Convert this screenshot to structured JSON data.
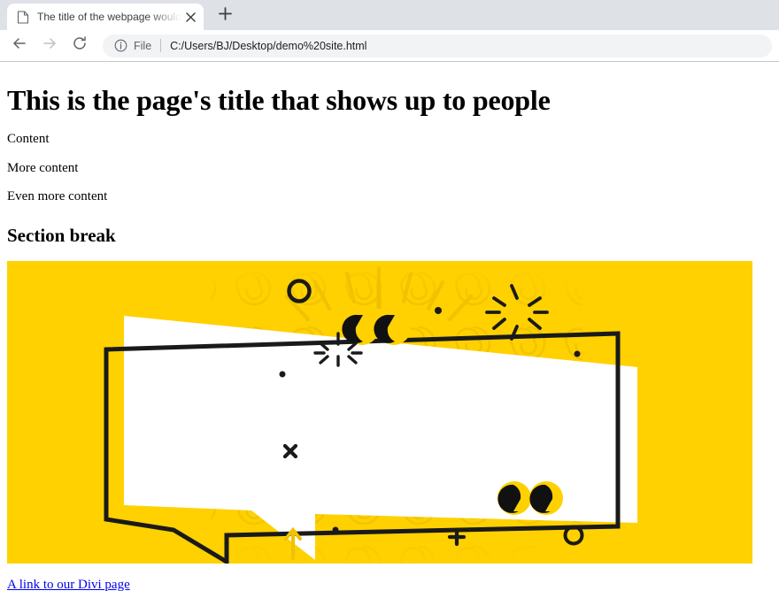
{
  "browser": {
    "tab": {
      "favicon_icon": "document-icon",
      "title": "The title of the webpage would g",
      "close_icon": "close-icon"
    },
    "new_tab_icon": "plus-icon",
    "toolbar": {
      "back_icon": "arrow-left-icon",
      "forward_icon": "arrow-right-icon",
      "reload_icon": "reload-icon",
      "info_icon": "info-circle-icon",
      "scheme_label": "File",
      "url": "C:/Users/BJ/Desktop/demo%20site.html"
    }
  },
  "page": {
    "heading": "This is the page's title that shows up to people",
    "paragraphs": [
      "Content",
      "More content",
      "Even more content"
    ],
    "section_heading": "Section break",
    "link_text": "A link to our Divi page"
  },
  "illustration": {
    "name": "yellow-speech-bubble-quote-graphic",
    "background_color": "#FFD100",
    "swirl_color": "#F2C200",
    "bubble_fill": "#FFFFFF",
    "outline_color": "#1A1A1A",
    "accent_color": "#FFD100",
    "open_quote": "“",
    "close_quote": "”",
    "decor": [
      "circle-outline-top-left",
      "sparkle-top-right",
      "sparkle-inner-left",
      "dot-top-center",
      "dot-right",
      "dot-left",
      "x-mark-left",
      "plus-mark-bottom",
      "circle-outline-bottom-right",
      "dot-bottom-left",
      "arrow-up-bottom-left"
    ]
  },
  "colors": {
    "tabbar_bg": "#DEE1E6",
    "toolbar_bg": "#FFFFFF",
    "omnibox_bg": "#F1F3F4",
    "link_blue": "#0000EE",
    "hero_yellow": "#FFD100"
  }
}
